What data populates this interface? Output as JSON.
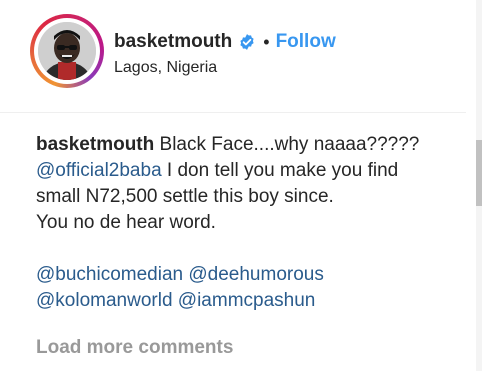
{
  "post_header": {
    "username": "basketmouth",
    "separator": "•",
    "follow_label": "Follow",
    "location": "Lagos, Nigeria",
    "verified_icon": "verified-badge-icon",
    "accent_color": "#3897f0"
  },
  "caption": {
    "username": "basketmouth",
    "line1_text": " Black Face....why naaaa?????",
    "line2_mention": "@official2baba",
    "line2_text": " I don tell you make you find",
    "line3": "small N72,500 settle this boy since.",
    "line4": "You no de hear word.",
    "mentions_line1": [
      "@buchicomedian",
      "@deehumorous"
    ],
    "mentions_line2": [
      "@kolomanworld",
      "@iammcpashun"
    ]
  },
  "load_more_label": "Load more comments"
}
